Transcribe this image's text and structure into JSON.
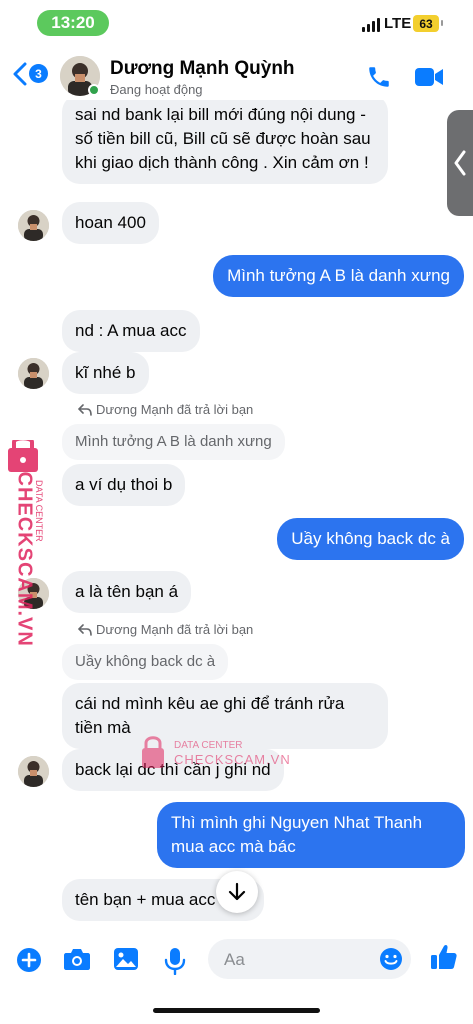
{
  "status_bar": {
    "time": "13:20",
    "network": "LTE",
    "battery": "63"
  },
  "header": {
    "back_badge": "3",
    "contact_name": "Dương Mạnh Quỳnh",
    "status": "Đang hoạt động",
    "icons": [
      "chevron-left-icon",
      "phone-icon",
      "video-camera-icon"
    ]
  },
  "messages": {
    "m1": "sai nd bank lại bill mới đúng nội dung - số tiền bill cũ, Bill cũ sẽ được hoàn sau khi giao dịch thành công . Xin cảm ơn !",
    "m2": "hoan 400",
    "m3": "Mình tưởng A B là danh xưng",
    "m4": "nd : A mua acc",
    "m5": "kĩ nhé b",
    "reply1_label": "Dương Mạnh đã trả lời bạn",
    "reply1_quote": "Mình tưởng A B là danh xưng",
    "m6": "a ví dụ thoi b",
    "m7": "Uầy không back dc à",
    "m8": "a là tên bạn á",
    "reply2_label": "Dương Mạnh đã trả lời bạn",
    "reply2_quote": "Uầy không back dc à",
    "m9": "cái nd mình kêu ae ghi để tránh rửa tiền mà",
    "m10": "back lại dc thì cần j ghi nd",
    "m11": "Thì mình ghi Nguyen Nhat Thanh mua acc mà bác",
    "m12": "tên bạn + mua acc là oi"
  },
  "watermark": {
    "vertical_text": "CHECKSCAM.VN",
    "vertical_sub": "DATA CENTER",
    "center_sub": "DATA CENTER",
    "center_text": "CHECKSCAM.VN"
  },
  "composer": {
    "placeholder": "Aa",
    "icons": [
      "plus-circle-icon",
      "camera-icon",
      "image-icon",
      "microphone-icon",
      "emoji-icon",
      "thumbs-up-icon"
    ]
  },
  "colors": {
    "accent": "#0a7cff",
    "outgoing_bubble": "#2c74ef",
    "incoming_bubble": "#eef0f3",
    "watermark": "#e0245e"
  }
}
